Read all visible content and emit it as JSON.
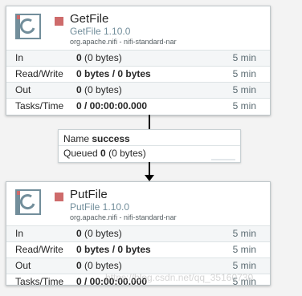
{
  "processors": [
    {
      "name": "GetFile",
      "type": "GetFile 1.10.0",
      "bundle": "org.apache.nifi - nifi-standard-nar",
      "stats": [
        {
          "label": "In",
          "value": "0",
          "detail": "(0 bytes)",
          "window": "5 min"
        },
        {
          "label": "Read/Write",
          "value": "0 bytes / 0 bytes",
          "detail": "",
          "window": "5 min"
        },
        {
          "label": "Out",
          "value": "0",
          "detail": "(0 bytes)",
          "window": "5 min"
        },
        {
          "label": "Tasks/Time",
          "value": "0 / 00:00:00.000",
          "detail": "",
          "window": "5 min"
        }
      ]
    },
    {
      "name": "PutFile",
      "type": "PutFile 1.10.0",
      "bundle": "org.apache.nifi - nifi-standard-nar",
      "stats": [
        {
          "label": "In",
          "value": "0",
          "detail": "(0 bytes)",
          "window": "5 min"
        },
        {
          "label": "Read/Write",
          "value": "0 bytes / 0 bytes",
          "detail": "",
          "window": "5 min"
        },
        {
          "label": "Out",
          "value": "0",
          "detail": "(0 bytes)",
          "window": "5 min"
        },
        {
          "label": "Tasks/Time",
          "value": "0 / 00:00:00.000",
          "detail": "",
          "window": "5 min"
        }
      ]
    }
  ],
  "connection": {
    "name_label": "Name",
    "name_value": "success",
    "queued_label": "Queued",
    "queued_value": "0",
    "queued_detail": "(0 bytes)"
  },
  "icons": {
    "processor": "processor-icon",
    "stopped": "stopped-icon"
  },
  "colors": {
    "stopped": "#ce6b6b",
    "type_text": "#728e9b"
  },
  "watermark": "https://blog.csdn.net/qq_35160730"
}
